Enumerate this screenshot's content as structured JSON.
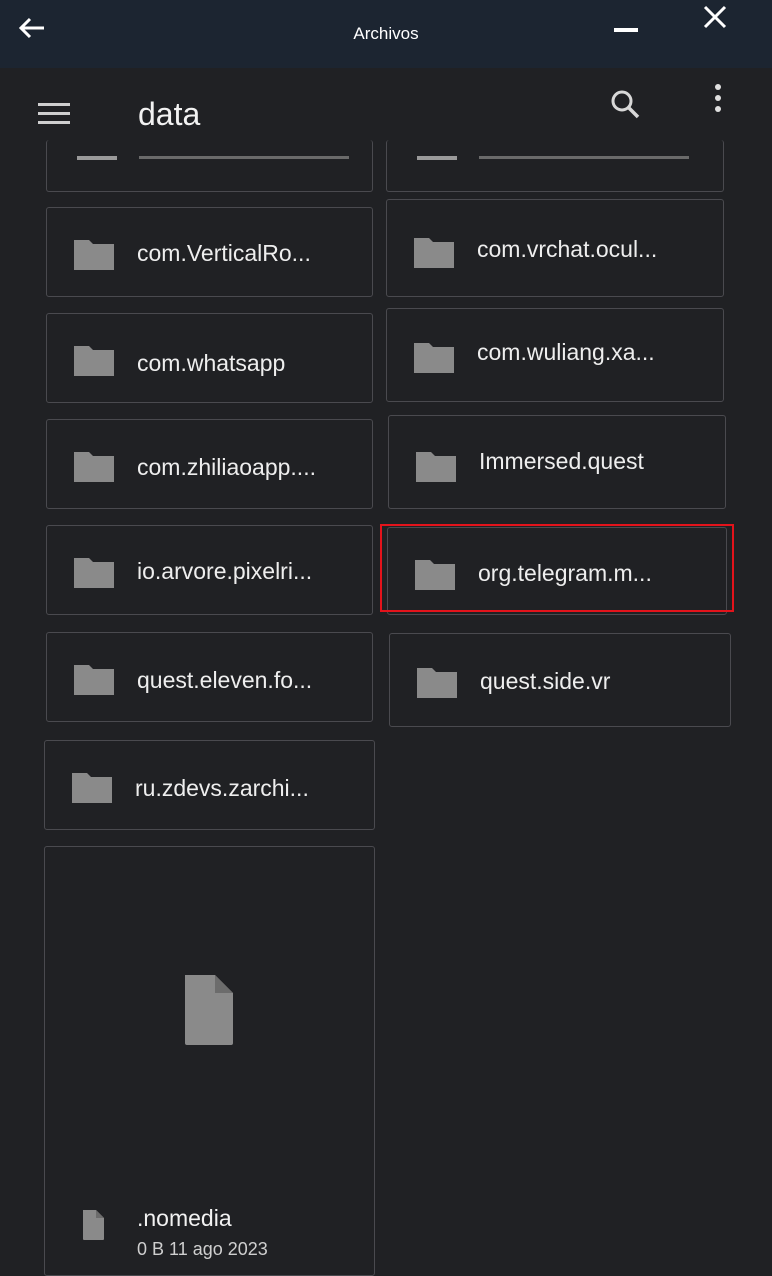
{
  "titlebar": {
    "title": "Archivos"
  },
  "appbar": {
    "folder_name": "data"
  },
  "items": [
    {
      "label": "com.VerticalRo..."
    },
    {
      "label": "com.vrchat.ocul..."
    },
    {
      "label": "com.whatsapp"
    },
    {
      "label": "com.wuliang.xa..."
    },
    {
      "label": "com.zhiliaoapp...."
    },
    {
      "label": "Immersed.quest"
    },
    {
      "label": "io.arvore.pixelri..."
    },
    {
      "label": "org.telegram.m..."
    },
    {
      "label": "quest.eleven.fo..."
    },
    {
      "label": "quest.side.vr"
    },
    {
      "label": "ru.zdevs.zarchi..."
    }
  ],
  "file": {
    "name": ".nomedia",
    "meta": "0 B 11 ago 2023"
  },
  "colors": {
    "background": "#202124",
    "titlebar": "#1c2531",
    "icon": "#8a8a8a",
    "highlight": "#e3131b"
  },
  "icons": [
    "back-arrow-icon",
    "minimize-icon",
    "close-icon",
    "menu-icon",
    "search-icon",
    "more-options-icon",
    "folder-icon",
    "file-icon"
  ]
}
